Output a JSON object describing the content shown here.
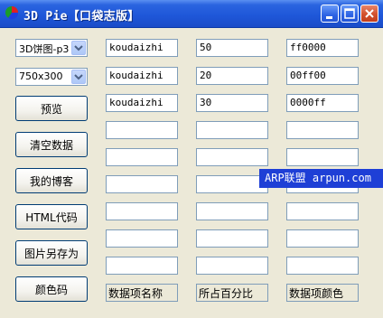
{
  "window": {
    "title": "3D Pie【口袋志版】",
    "controls": [
      "minimize",
      "maximize",
      "close"
    ]
  },
  "left": {
    "chart_select": "3D饼图-p3",
    "size_select": "750x300",
    "buttons": [
      "预览",
      "清空数据",
      "我的博客",
      "HTML代码",
      "图片另存为",
      "颜色码"
    ]
  },
  "rows": [
    {
      "name": "koudaizhi",
      "percent": "50",
      "color": "ff0000"
    },
    {
      "name": "koudaizhi",
      "percent": "20",
      "color": "00ff00"
    },
    {
      "name": "koudaizhi",
      "percent": "30",
      "color": "0000ff"
    },
    {
      "name": "",
      "percent": "",
      "color": ""
    },
    {
      "name": "",
      "percent": "",
      "color": ""
    },
    {
      "name": "",
      "percent": "",
      "color": ""
    },
    {
      "name": "",
      "percent": "",
      "color": ""
    },
    {
      "name": "",
      "percent": "",
      "color": ""
    },
    {
      "name": "",
      "percent": "",
      "color": ""
    }
  ],
  "column_labels": {
    "name": "数据项名称",
    "percent": "所占百分比",
    "color": "数据项颜色"
  },
  "overlay": "ARP联盟 arpun.com"
}
